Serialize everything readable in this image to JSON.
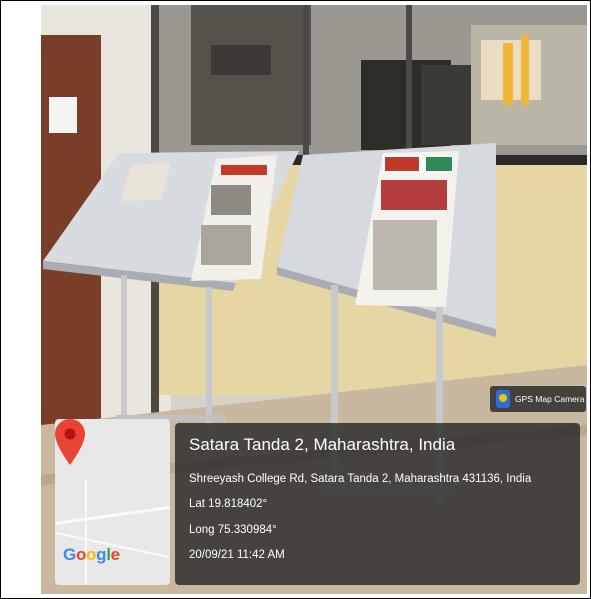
{
  "photo": {
    "scene": "library newspaper reading stands",
    "newspapers": {
      "left_masthead": "Lokmat Times",
      "right_masthead": "दिव्य सिटी"
    }
  },
  "overlay": {
    "camera_badge": {
      "icon": "gps-map-camera-icon",
      "label": "GPS Map Camera"
    },
    "map": {
      "logo": "Google",
      "pin_color": "#ea4335",
      "icon": "map-pin-icon"
    },
    "location": {
      "title": "Satara Tanda 2, Maharashtra, India",
      "address": "Shreeyash College Rd, Satara Tanda 2, Maharashtra 431136, India",
      "latitude": "Lat 19.818402°",
      "longitude": "Long 75.330984°",
      "datetime": "20/09/21 11:42 AM"
    }
  }
}
